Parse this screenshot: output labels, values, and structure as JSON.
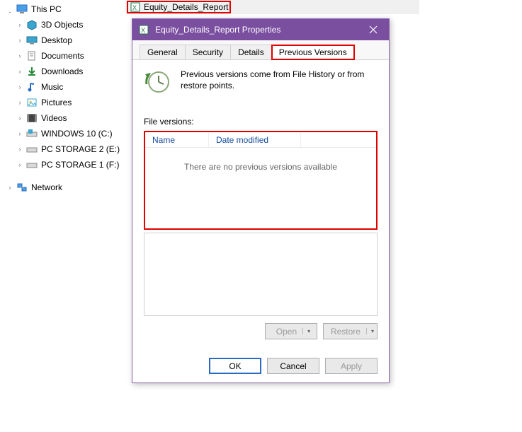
{
  "tree": {
    "root": "This PC",
    "items": [
      {
        "label": "3D Objects"
      },
      {
        "label": "Desktop"
      },
      {
        "label": "Documents"
      },
      {
        "label": "Downloads"
      },
      {
        "label": "Music"
      },
      {
        "label": "Pictures"
      },
      {
        "label": "Videos"
      },
      {
        "label": "WINDOWS 10 (C:)"
      },
      {
        "label": "PC STORAGE 2 (E:)"
      },
      {
        "label": "PC STORAGE 1 (F:)"
      }
    ],
    "network": "Network"
  },
  "file": {
    "name": "Equity_Details_Report"
  },
  "dialog": {
    "title": "Equity_Details_Report Properties",
    "tabs": {
      "general": "General",
      "security": "Security",
      "details": "Details",
      "previous": "Previous Versions"
    },
    "info": "Previous versions come from File History or from restore points.",
    "section_label": "File versions:",
    "columns": {
      "name": "Name",
      "modified": "Date modified"
    },
    "empty": "There are no previous versions available",
    "buttons": {
      "open": "Open",
      "restore": "Restore",
      "ok": "OK",
      "cancel": "Cancel",
      "apply": "Apply"
    }
  }
}
